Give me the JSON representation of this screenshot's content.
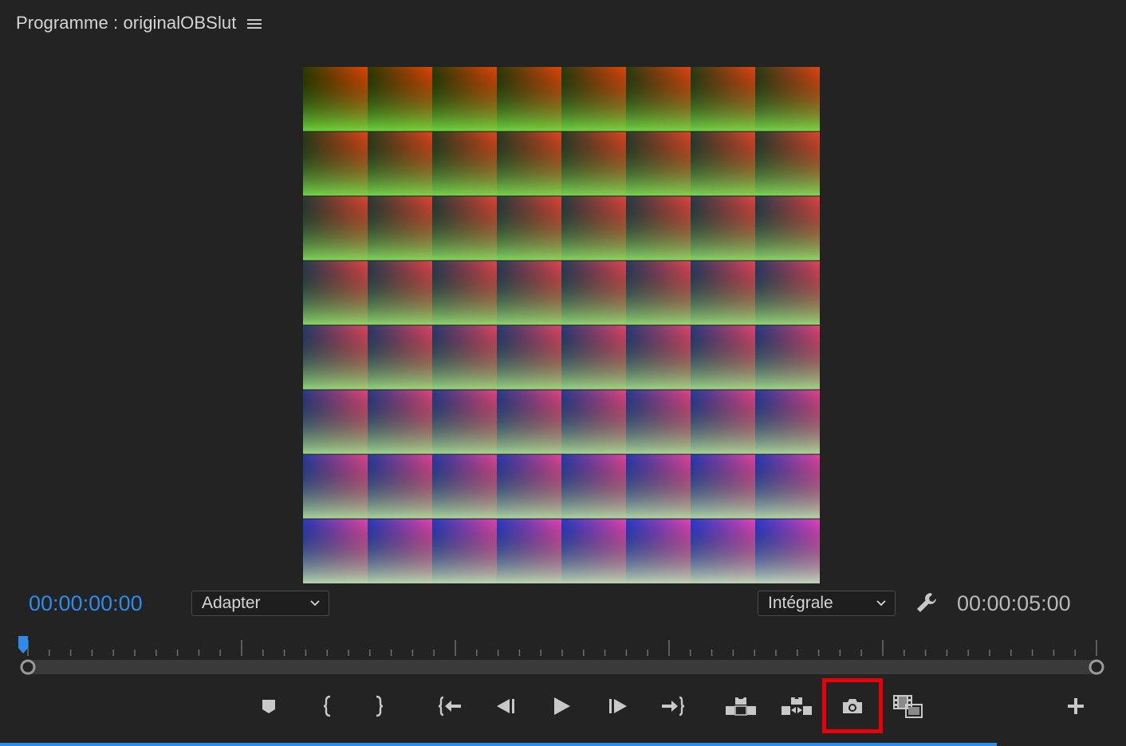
{
  "panel": {
    "title": "Programme : originalOBSlut",
    "menu_icon": "hamburger-menu-icon"
  },
  "viewer": {
    "content": "color-lut-grid",
    "grid_rows": 8,
    "grid_cols": 8
  },
  "timecode": {
    "current": "00:00:00:00",
    "duration": "00:00:05:00",
    "current_color": "#2d8ceb"
  },
  "zoom_select": {
    "selected": "Adapter"
  },
  "resolution_select": {
    "selected": "Intégrale"
  },
  "settings": {
    "icon": "wrench-icon"
  },
  "transport": {
    "buttons": [
      {
        "name": "add-marker-button",
        "icon": "marker-icon"
      },
      {
        "name": "mark-in-button",
        "icon": "mark-in-icon"
      },
      {
        "name": "mark-out-button",
        "icon": "mark-out-icon"
      },
      {
        "name": "go-to-in-button",
        "icon": "go-to-in-icon"
      },
      {
        "name": "step-back-button",
        "icon": "step-back-icon"
      },
      {
        "name": "play-button",
        "icon": "play-icon"
      },
      {
        "name": "step-forward-button",
        "icon": "step-forward-icon"
      },
      {
        "name": "go-to-out-button",
        "icon": "go-to-out-icon"
      },
      {
        "name": "lift-button",
        "icon": "lift-icon"
      },
      {
        "name": "extract-button",
        "icon": "extract-icon"
      },
      {
        "name": "export-frame-button",
        "icon": "camera-icon",
        "highlighted": true
      },
      {
        "name": "comparison-view-button",
        "icon": "film-compare-icon"
      },
      {
        "name": "button-editor-button",
        "icon": "plus-icon"
      }
    ]
  },
  "colors": {
    "background": "#232323",
    "accent": "#2d8ceb",
    "highlight": "#e8000a",
    "icon": "#c8c8c8"
  }
}
